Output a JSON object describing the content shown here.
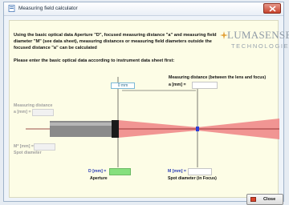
{
  "window": {
    "title": "Measuring field calculator"
  },
  "intro_text": "Using the basic optical data Aperture \"D\", focused measuring distance \"a\" and measuring field diameter \"M\" (see data sheet), measuring distances or measuring field diameters outside the focused distance \"a\" can be calculated",
  "instruction_text": "Please enter the basic optical data according to instrument data sheet first:",
  "logo": {
    "main": "LUMASENSE",
    "sub": "TECHNOLOGIES"
  },
  "measuring_distance_header": "Measuring distance (between the lens and focus)",
  "focus_distance": {
    "label": "a [mm] =",
    "value": ""
  },
  "zero_marker": "0 mm",
  "left_side": {
    "distance_title": "Measuring distance",
    "distance_label": "a [mm] =",
    "distance_value": "",
    "spot_label": "M* [mm] =",
    "spot_value": "",
    "spot_title": "Spot diameter"
  },
  "aperture": {
    "label": "D [mm] =",
    "value": "",
    "title": "Aperture"
  },
  "spot_focus": {
    "label": "M [mm] =",
    "value": "",
    "title": "Spot diameter (in Focus)"
  },
  "close_button_label": "Close",
  "colors": {
    "beam": "#f08a8a",
    "sensor_body": "#8a8a8a",
    "focus_marker": "#2d3fd8",
    "aperture_field": "#86e07e"
  }
}
